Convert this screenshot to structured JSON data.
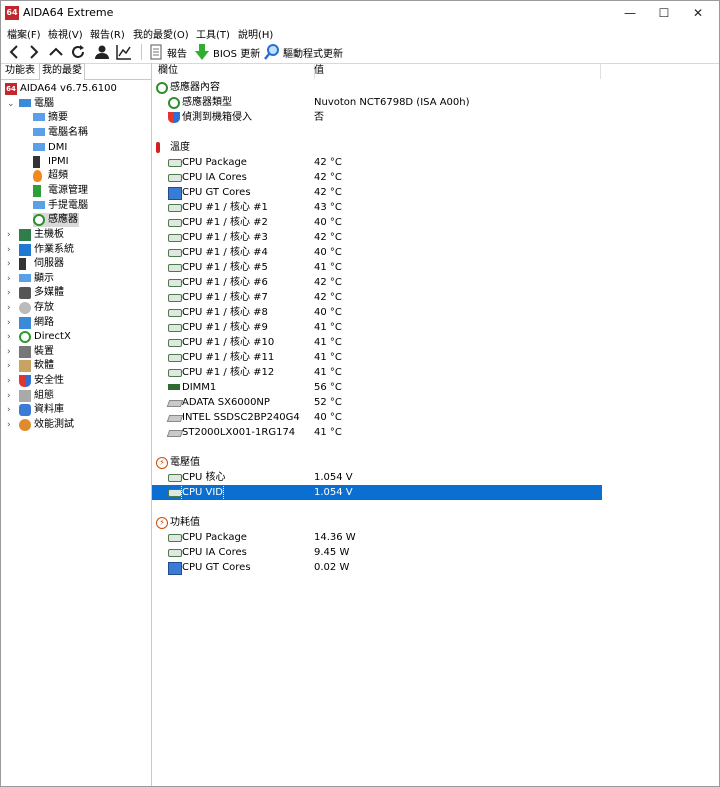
{
  "window": {
    "app_icon_text": "64",
    "title": "AIDA64 Extreme",
    "minimize": "—",
    "maximize": "☐",
    "close": "✕"
  },
  "menu": [
    "檔案(F)",
    "檢視(V)",
    "報告(R)",
    "我的最愛(O)",
    "工具(T)",
    "說明(H)"
  ],
  "toolbar": {
    "report_label": "報告",
    "bios_label": "BIOS 更新",
    "driver_label": "驅動程式更新"
  },
  "left_panel": {
    "tabs": [
      "功能表",
      "我的最愛"
    ],
    "root": "AIDA64 v6.75.6100",
    "computer": "電腦",
    "computer_children": [
      "摘要",
      "電腦名稱",
      "DMI",
      "IPMI",
      "超頻",
      "電源管理",
      "手提電腦",
      "感應器"
    ],
    "categories": [
      "主機板",
      "作業系統",
      "伺服器",
      "顯示",
      "多媒體",
      "存放",
      "網路",
      "DirectX",
      "裝置",
      "軟體",
      "安全性",
      "組態",
      "資料庫",
      "效能測試"
    ]
  },
  "columns": {
    "field": "欄位",
    "value": "值"
  },
  "sections": {
    "sensor_props": {
      "title": "感應器內容",
      "rows": [
        {
          "field": "感應器類型",
          "value": "Nuvoton NCT6798D  (ISA A00h)"
        },
        {
          "field": "偵測到機箱侵入",
          "value": "否"
        }
      ]
    },
    "temperature": {
      "title": "溫度",
      "rows": [
        {
          "field": "CPU Package",
          "value": "42 °C"
        },
        {
          "field": "CPU IA Cores",
          "value": "42 °C"
        },
        {
          "field": "CPU GT Cores",
          "value": "42 °C"
        },
        {
          "field": "CPU #1 / 核心 #1",
          "value": "43 °C"
        },
        {
          "field": "CPU #1 / 核心 #2",
          "value": "40 °C"
        },
        {
          "field": "CPU #1 / 核心 #3",
          "value": "42 °C"
        },
        {
          "field": "CPU #1 / 核心 #4",
          "value": "40 °C"
        },
        {
          "field": "CPU #1 / 核心 #5",
          "value": "41 °C"
        },
        {
          "field": "CPU #1 / 核心 #6",
          "value": "42 °C"
        },
        {
          "field": "CPU #1 / 核心 #7",
          "value": "42 °C"
        },
        {
          "field": "CPU #1 / 核心 #8",
          "value": "40 °C"
        },
        {
          "field": "CPU #1 / 核心 #9",
          "value": "41 °C"
        },
        {
          "field": "CPU #1 / 核心 #10",
          "value": "41 °C"
        },
        {
          "field": "CPU #1 / 核心 #11",
          "value": "41 °C"
        },
        {
          "field": "CPU #1 / 核心 #12",
          "value": "41 °C"
        },
        {
          "field": "DIMM1",
          "value": "56 °C"
        },
        {
          "field": "ADATA SX6000NP",
          "value": "52 °C"
        },
        {
          "field": "INTEL SSDSC2BP240G4",
          "value": "40 °C"
        },
        {
          "field": "ST2000LX001-1RG174",
          "value": "41 °C"
        }
      ]
    },
    "voltage": {
      "title": "電壓值",
      "rows": [
        {
          "field": "CPU 核心",
          "value": "1.054 V"
        },
        {
          "field": "CPU VID",
          "value": "1.054 V"
        }
      ]
    },
    "power": {
      "title": "功耗值",
      "rows": [
        {
          "field": "CPU Package",
          "value": "14.36 W"
        },
        {
          "field": "CPU IA Cores",
          "value": "9.45 W"
        },
        {
          "field": "CPU GT Cores",
          "value": "0.02 W"
        }
      ]
    }
  },
  "colors": {
    "selection": "#0a6fd0",
    "brand": "#c1272d"
  }
}
